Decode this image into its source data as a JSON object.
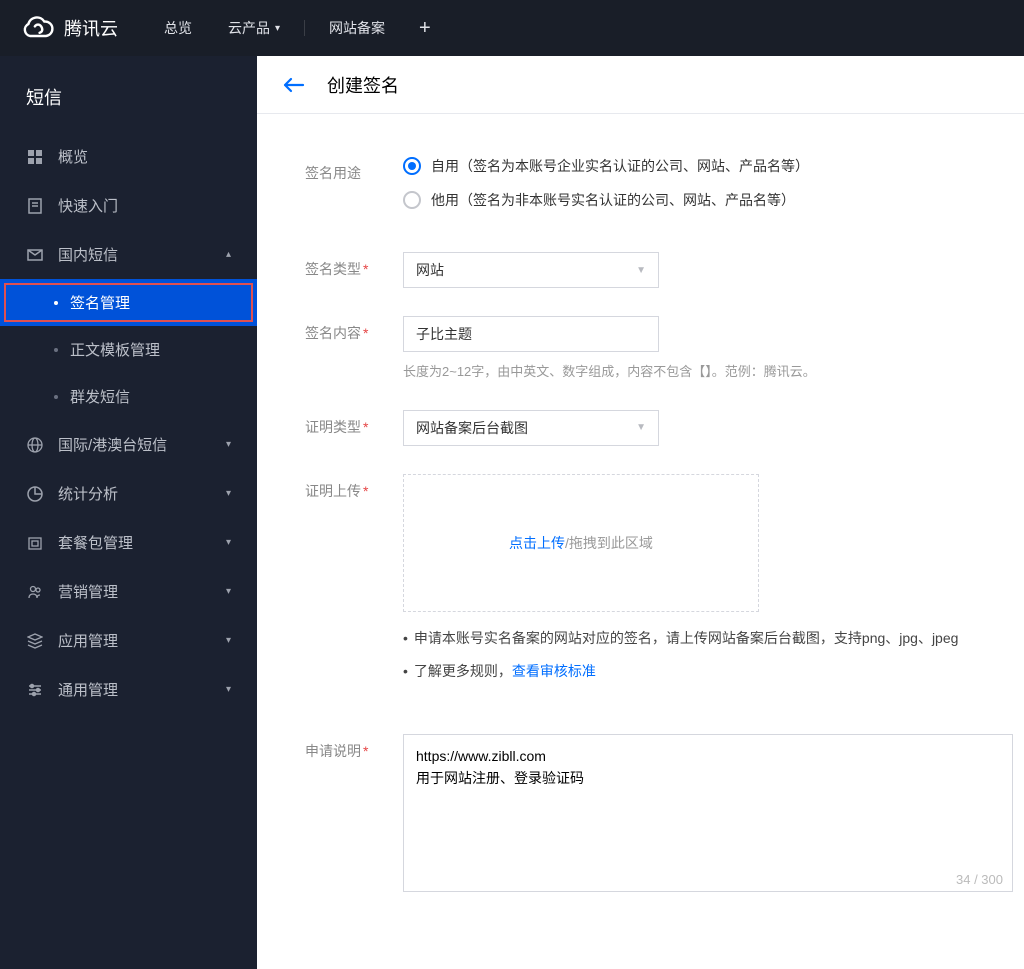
{
  "topbar": {
    "brand": "腾讯云",
    "items": [
      "总览",
      "云产品",
      "网站备案"
    ]
  },
  "sidebar": {
    "title": "短信",
    "items": [
      {
        "icon": "grid",
        "label": "概览"
      },
      {
        "icon": "doc",
        "label": "快速入门"
      },
      {
        "icon": "mail",
        "label": "国内短信",
        "expanded": true,
        "children": [
          {
            "label": "签名管理",
            "active": true,
            "highlight": true
          },
          {
            "label": "正文模板管理"
          },
          {
            "label": "群发短信"
          }
        ]
      },
      {
        "icon": "globe",
        "label": "国际/港澳台短信",
        "exp": true
      },
      {
        "icon": "chart",
        "label": "统计分析",
        "exp": true
      },
      {
        "icon": "box",
        "label": "套餐包管理",
        "exp": true
      },
      {
        "icon": "people",
        "label": "营销管理",
        "exp": true
      },
      {
        "icon": "layers",
        "label": "应用管理",
        "exp": true
      },
      {
        "icon": "sliders",
        "label": "通用管理",
        "exp": true
      }
    ]
  },
  "page": {
    "title": "创建签名"
  },
  "form": {
    "purpose": {
      "label": "签名用途",
      "options": [
        {
          "text": "自用（签名为本账号企业实名认证的公司、网站、产品名等）",
          "selected": true
        },
        {
          "text": "他用（签名为非本账号实名认证的公司、网站、产品名等）",
          "selected": false
        }
      ]
    },
    "sigType": {
      "label": "签名类型",
      "value": "网站"
    },
    "sigContent": {
      "label": "签名内容",
      "value": "子比主题",
      "hint": "长度为2~12字，由中英文、数字组成，内容不包含【】。范例：腾讯云。"
    },
    "proofType": {
      "label": "证明类型",
      "value": "网站备案后台截图"
    },
    "proofUpload": {
      "label": "证明上传",
      "clickText": "点击上传",
      "dragText": "/拖拽到此区域",
      "bullet1": "申请本账号实名备案的网站对应的签名，请上传网站备案后台截图，支持png、jpg、jpeg",
      "bullet2a": "了解更多规则，",
      "bullet2link": "查看审核标准"
    },
    "desc": {
      "label": "申请说明",
      "value": "https://www.zibll.com\n用于网站注册、登录验证码",
      "count": "34 / 300"
    }
  }
}
